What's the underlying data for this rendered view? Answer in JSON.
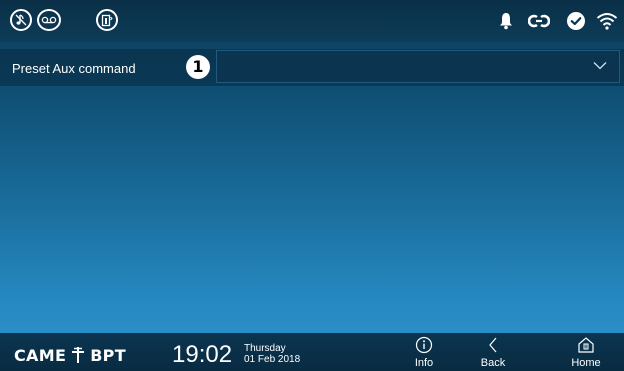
{
  "top_bar": {
    "left_icons": [
      "mute-ringtone-icon",
      "answering-machine-icon",
      "door-open-icon"
    ],
    "right_icons": [
      "bell-icon",
      "link-icon",
      "check-circle-icon",
      "wifi-icon"
    ]
  },
  "setting": {
    "label": "Preset Aux command",
    "badge": "1",
    "selected_value": ""
  },
  "bottom_bar": {
    "brand_left": "CAME",
    "brand_right": "BPT",
    "time": "19:02",
    "day": "Thursday",
    "date": "01 Feb 2018",
    "nav": {
      "info": "Info",
      "back": "Back",
      "home": "Home"
    }
  },
  "colors": {
    "top_bar": "#0b3450",
    "background_top": "#0c3a55",
    "background_bottom": "#2f95cc",
    "text": "#ffffff"
  }
}
